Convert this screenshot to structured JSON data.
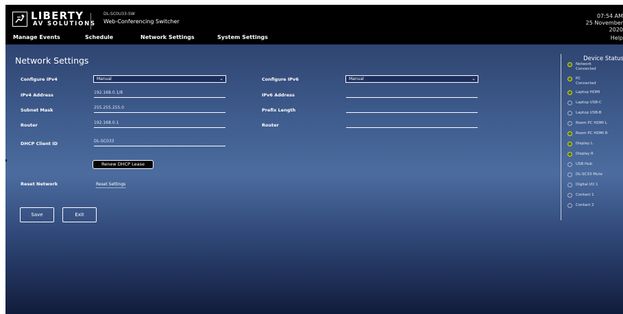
{
  "header": {
    "logo_line1": "LIBERTY",
    "logo_line2": "AV SOLUTIONS",
    "product_model": "DL-SC0U33-SW",
    "product_name": "Web-Conferencing Switcher",
    "clock_time": "07:54 AM",
    "clock_date": "25 November",
    "clock_year": "2020",
    "help_label": "Help"
  },
  "nav": [
    {
      "label": "Manage Events"
    },
    {
      "label": "Schedule"
    },
    {
      "label": "Network Settings"
    },
    {
      "label": "System Settings"
    }
  ],
  "network": {
    "title": "Network Settings",
    "ipv4": {
      "configure_label": "Configure IPv4",
      "configure_value": "Manual",
      "address_label": "IPv4 Address",
      "address_value": "192.168.0.1/8",
      "subnet_label": "Subnet Mask",
      "subnet_value": "255.255.255.0",
      "router_label": "Router",
      "router_value": "192.168.0.1",
      "dhcp_label": "DHCP Client ID",
      "dhcp_value": "DL-SC033"
    },
    "ipv6": {
      "configure_label": "Configure IPv6",
      "configure_value": "Manual",
      "address_label": "IPv6 Address",
      "address_value": "",
      "prefix_label": "Prefix Length",
      "prefix_value": "",
      "router_label": "Router",
      "router_value": ""
    },
    "renew_label": "Renew DHCP Lease",
    "reset_network_label": "Reset Network",
    "reset_settings_label": "Reset Settings",
    "save_label": "Save",
    "exit_label": "Exit"
  },
  "device_status": {
    "title": "Device Status",
    "items": [
      {
        "label": "Network",
        "sub": "Connected",
        "on": true
      },
      {
        "label": "PC",
        "sub": "Connected",
        "on": true
      },
      {
        "label": "Laptop HDMI",
        "on": true
      },
      {
        "label": "Laptop USB-C",
        "on": false
      },
      {
        "label": "Laptop USB-B",
        "on": false
      },
      {
        "label": "Room PC HDMI L",
        "on": false
      },
      {
        "label": "Room PC HDMI R",
        "on": true
      },
      {
        "label": "Display L",
        "on": true
      },
      {
        "label": "Display R",
        "on": true
      },
      {
        "label": "USB Hub",
        "on": false
      },
      {
        "label": "DL-SC33 Mute",
        "on": false
      },
      {
        "label": "Digital I/O 1",
        "on": false
      },
      {
        "label": "Contact 1",
        "on": false
      },
      {
        "label": "Contact 2",
        "on": false
      }
    ]
  },
  "colors": {
    "header_bg": "#000000",
    "status_on": "#c8de36",
    "select_bg": "#1d2f5d"
  }
}
